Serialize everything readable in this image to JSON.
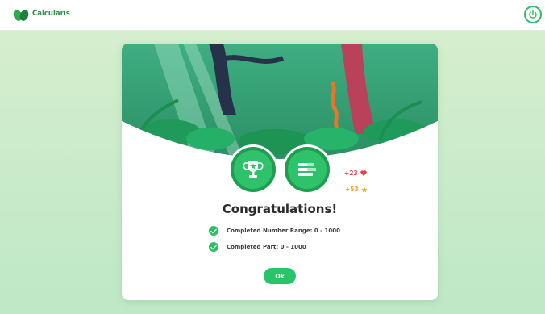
{
  "app": {
    "name": "Calcularis",
    "logo_icon": "leaf-logo-icon",
    "power_icon": "power-icon",
    "accent": "#2fbf63"
  },
  "dialog": {
    "title": "Congratulations!",
    "badges": [
      "trophy-icon",
      "levels-icon"
    ],
    "rewards": {
      "hearts": "+23",
      "hearts_icon": "heart-icon",
      "stars": "+53",
      "stars_icon": "star-icon"
    },
    "items": [
      {
        "label": "Completed Number Range: 0 - 1000"
      },
      {
        "label": "Completed Part: 0 - 1000"
      }
    ],
    "ok_label": "Ok"
  }
}
